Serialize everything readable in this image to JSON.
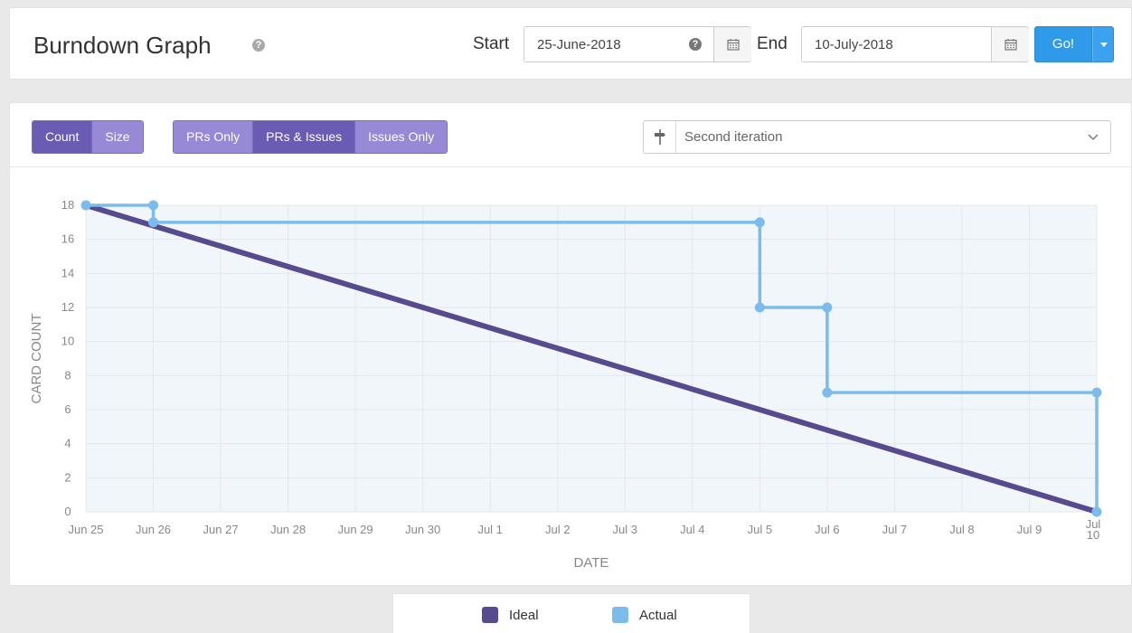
{
  "header": {
    "title": "Burndown Graph",
    "help_glyph": "?",
    "start_label": "Start",
    "start_value": "25-June-2018",
    "end_label": "End",
    "end_value": "10-July-2018",
    "go_label": "Go!"
  },
  "toolbar": {
    "metric_buttons": [
      {
        "label": "Count",
        "active": true
      },
      {
        "label": "Size",
        "active": false
      }
    ],
    "filter_buttons": [
      {
        "label": "PRs Only",
        "active": false
      },
      {
        "label": "PRs & Issues",
        "active": true
      },
      {
        "label": "Issues Only",
        "active": false
      }
    ],
    "iteration": "Second iteration"
  },
  "icons": {
    "title_help": "question-circle-icon",
    "start_help": "question-circle-icon",
    "calendar": "calendar-icon",
    "go_dropdown": "caret-down-icon",
    "iteration": "milestone-icon",
    "select_dropdown": "chevron-down-icon"
  },
  "colors": {
    "ideal": "#574a8f",
    "actual": "#7cbcec",
    "area_fill": "#f1f6fb",
    "primary_button": "#2f9ae8",
    "segment_active": "#6a5bb3",
    "segment_inactive": "#9889d6"
  },
  "chart_data": {
    "type": "line",
    "xlabel": "DATE",
    "ylabel": "CARD COUNT",
    "ylim": [
      0,
      18
    ],
    "xlim": [
      "2018-06-25",
      "2018-07-10"
    ],
    "y_ticks": [
      0,
      2,
      4,
      6,
      8,
      10,
      12,
      14,
      16,
      18
    ],
    "x_ticks": [
      "Jun 25",
      "Jun 26",
      "Jun 27",
      "Jun 28",
      "Jun 29",
      "Jun 30",
      "Jul 1",
      "Jul 2",
      "Jul 3",
      "Jul 4",
      "Jul 5",
      "Jul 6",
      "Jul 7",
      "Jul 8",
      "Jul 9",
      "Jul 10"
    ],
    "grid": true,
    "legend": "bottom",
    "series": [
      {
        "name": "Ideal",
        "x": [
          "2018-06-25",
          "2018-07-10"
        ],
        "y": [
          18,
          0
        ]
      },
      {
        "name": "Actual",
        "step": true,
        "x": [
          "2018-06-25",
          "2018-06-26",
          "2018-06-26",
          "2018-07-05",
          "2018-07-05",
          "2018-07-06",
          "2018-07-06",
          "2018-07-10",
          "2018-07-10"
        ],
        "y": [
          18,
          18,
          17,
          17,
          12,
          12,
          7,
          7,
          0
        ]
      }
    ]
  }
}
